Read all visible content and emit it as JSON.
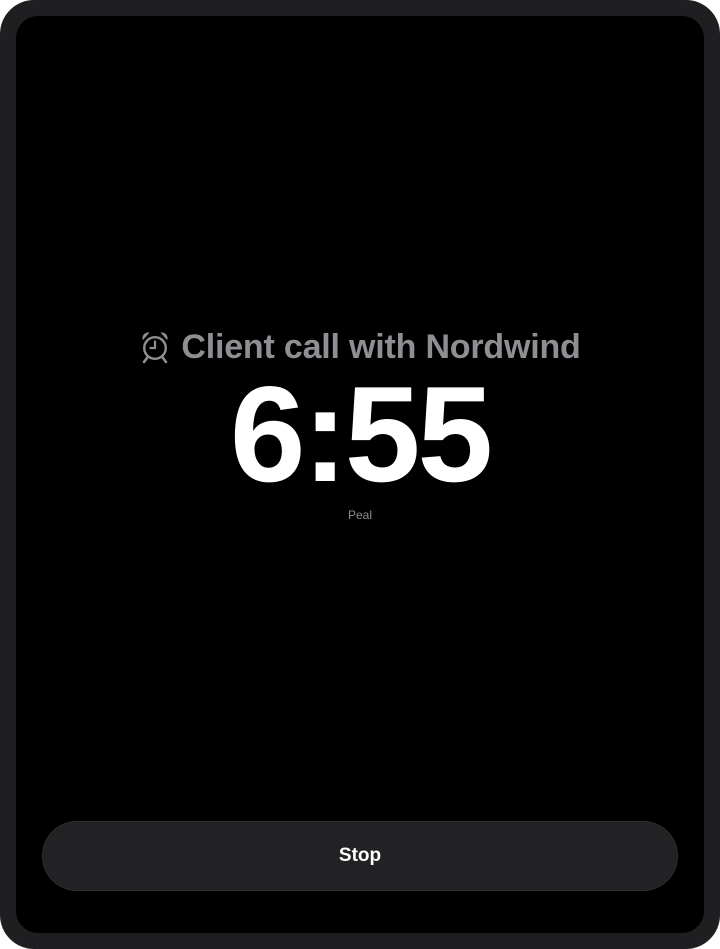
{
  "alarm": {
    "icon": "alarm-clock-icon",
    "title": "Client call with Nordwind",
    "time": "6:55",
    "sound": "Peal"
  },
  "actions": {
    "stop_label": "Stop"
  },
  "colors": {
    "background": "#000000",
    "frame": "#1f1f21",
    "title_gray": "#8e8e93",
    "time_white": "#ffffff",
    "button_fill": "#222224"
  }
}
